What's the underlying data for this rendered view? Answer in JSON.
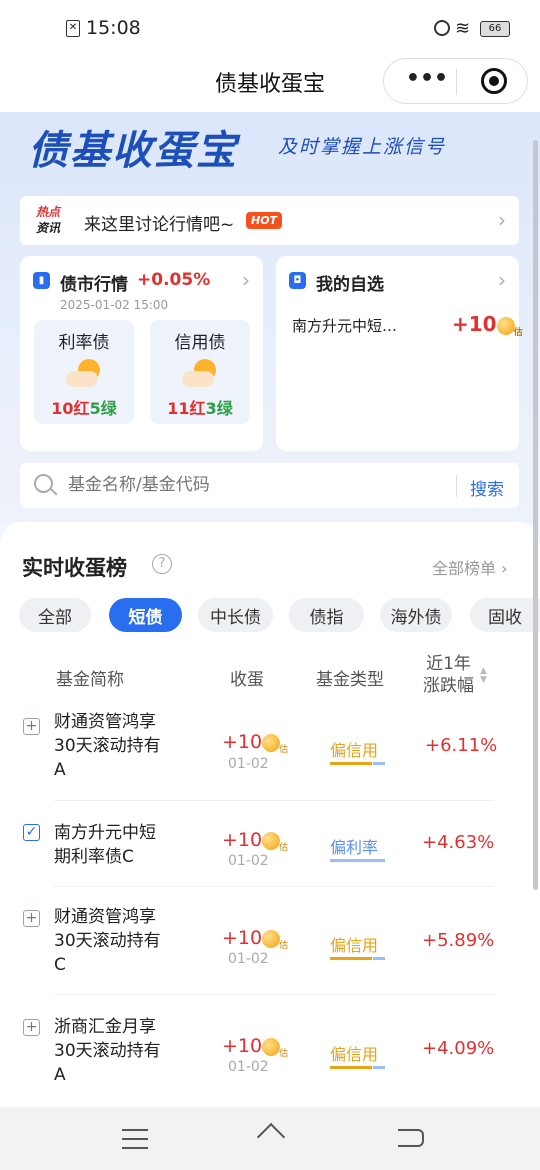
{
  "status": {
    "time": "15:08",
    "battery": "66"
  },
  "nav": {
    "title": "债基收蛋宝"
  },
  "banner": {
    "title": "债基收蛋宝",
    "slogan": "及时掌握上涨信号"
  },
  "news": {
    "tag_line1": "热点",
    "tag_line2": "资讯",
    "text": "来这里讨论行情吧~",
    "hot": "HOT"
  },
  "market": {
    "title": "债市行情",
    "change": "+0.05%",
    "time": "2025-01-02 15:00",
    "cards": [
      {
        "label": "利率债",
        "red": "10红",
        "green": "5绿"
      },
      {
        "label": "信用债",
        "red": "11红",
        "green": "3绿"
      }
    ]
  },
  "favorites": {
    "title": "我的自选",
    "fund": "南方升元中短…",
    "value": "+10",
    "badge": "估"
  },
  "search": {
    "placeholder": "基金名称/基金代码",
    "button": "搜索"
  },
  "ranking": {
    "title": "实时收蛋榜",
    "all_link": "全部榜单",
    "tabs": [
      "全部",
      "短债",
      "中长债",
      "债指",
      "海外债",
      "固收"
    ],
    "active_tab": 1,
    "headers": {
      "name": "基金简称",
      "egg": "收蛋",
      "type": "基金类型",
      "change_line1": "近1年",
      "change_line2": "涨跌幅"
    },
    "rows": [
      {
        "name_lines": [
          "财通资管鸿享",
          "30天滚动持有",
          "A"
        ],
        "egg": "+10",
        "badge": "估",
        "date": "01-02",
        "type": "偏信用",
        "change": "+6.11%",
        "checked": false
      },
      {
        "name_lines": [
          "南方升元中短",
          "期利率债C"
        ],
        "egg": "+10",
        "badge": "估",
        "date": "01-02",
        "type": "偏利率",
        "change": "+4.63%",
        "checked": true
      },
      {
        "name_lines": [
          "财通资管鸿享",
          "30天滚动持有",
          "C"
        ],
        "egg": "+10",
        "badge": "估",
        "date": "01-02",
        "type": "偏信用",
        "change": "+5.89%",
        "checked": false
      },
      {
        "name_lines": [
          "浙商汇金月享",
          "30天滚动持有",
          "A"
        ],
        "egg": "+10",
        "badge": "估",
        "date": "01-02",
        "type": "偏信用",
        "change": "+4.09%",
        "checked": false
      }
    ]
  },
  "colors": {
    "accent": "#2a6ef0",
    "up": "#e03131",
    "down": "#2e9d47",
    "credit": "#e8a317",
    "rate": "#5b8ff0"
  }
}
